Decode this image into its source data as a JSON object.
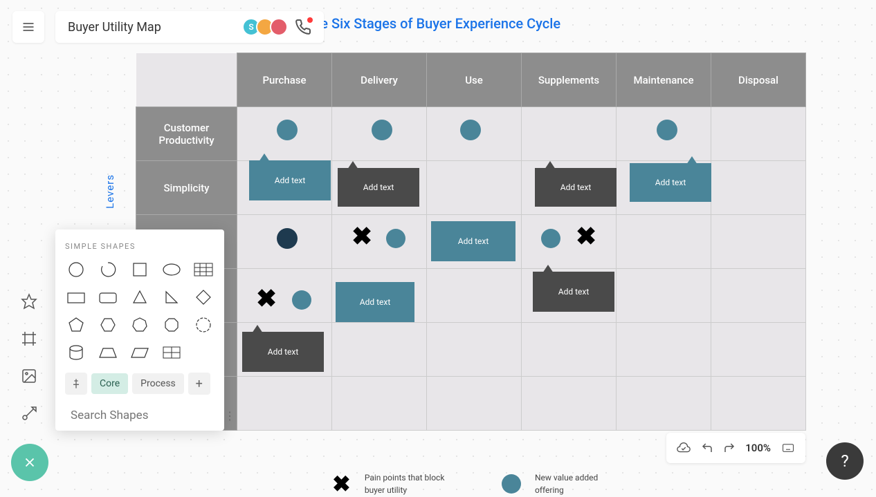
{
  "title": "Buyer Utility Map",
  "heading": "The   Six   Stages   of  Buyer   Experience   Cycle",
  "avatar_letter": "S",
  "levers_label": "Levers",
  "columns": [
    "Purchase",
    "Delivery",
    "Use",
    "Supplements",
    "Maintenance",
    "Disposal"
  ],
  "rows": [
    "Customer Productivity",
    "Simplicity",
    "",
    "",
    "",
    ""
  ],
  "notes": {
    "add_text": "Add   text"
  },
  "shapes_panel": {
    "header": "SIMPLE SHAPES",
    "tabs": {
      "core": "Core",
      "process": "Process"
    },
    "search_placeholder": "Search Shapes"
  },
  "legend": {
    "pain": "Pain   points   that block   buyer   utility",
    "new": "New   value   added offering"
  },
  "zoom": "100%"
}
